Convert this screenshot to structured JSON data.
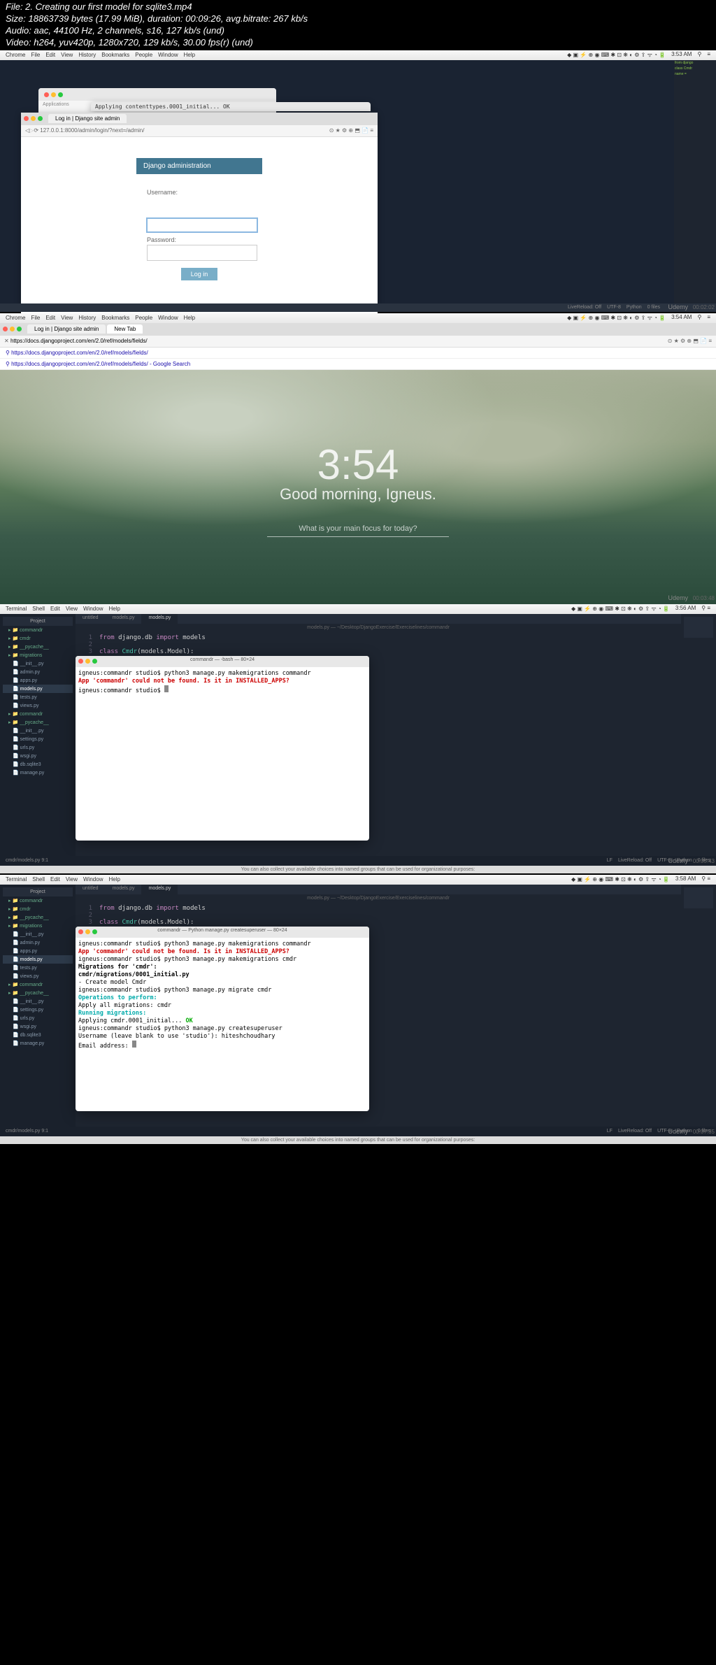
{
  "meta": {
    "l1": "File: 2. Creating our first model for sqlite3.mp4",
    "l2": "Size: 18863739 bytes (17.99 MiB), duration: 00:09:26, avg.bitrate: 267 kb/s",
    "l3": "Audio: aac, 44100 Hz, 2 channels, s16, 127 kb/s (und)",
    "l4": "Video: h264, yuv420p, 1280x720, 129 kb/s, 30.00 fps(r) (und)"
  },
  "menubar": {
    "chrome": [
      "Chrome",
      "File",
      "Edit",
      "View",
      "History",
      "Bookmarks",
      "People",
      "Window",
      "Help"
    ],
    "terminal": [
      "Terminal",
      "Shell",
      "Edit",
      "View",
      "Window",
      "Help"
    ],
    "time1": "3:53 AM",
    "time2": "3:54 AM",
    "time3": "3:56 AM",
    "time4": "3:58 AM"
  },
  "s1": {
    "finder_title": "Applications",
    "term_line": "Applying contenttypes.0001_initial... OK",
    "tab": "Log in | Django site admin",
    "url": "127.0.0.1:8000/admin/login/?next=/admin/",
    "django_hdr": "Django administration",
    "lbl_user": "Username:",
    "lbl_pass": "Password:",
    "btn": "Log in",
    "status": [
      "LiveReload: Off",
      "UTF-8",
      "Python",
      "0 files"
    ],
    "brand": "Udemy",
    "ts": "00:02:02"
  },
  "s2": {
    "tab1": "Log in | Django site admin",
    "tab2": "New Tab",
    "url": "https://docs.djangoproject.com/en/2.0/ref/models/fields/",
    "sugg1": "https://docs.djangoproject.com/en/2.0/ref/models/fields/",
    "sugg2": "https://docs.djangoproject.com/en/2.0/ref/models/fields/ - Google Search",
    "clock": "3:54",
    "greet": "Good morning, Igneus.",
    "focus": "What is your main focus for today?",
    "brand": "Udemy",
    "ts": "00:03:48"
  },
  "ide": {
    "path": "models.py — ~/Desktop/DjangoExercise/Exerciselines/commandr",
    "hdr": "Project",
    "tree": [
      "commandr",
      "cmdr",
      "__pycache__",
      "migrations",
      "__init__.py",
      "admin.py",
      "apps.py",
      "models.py",
      "tests.py",
      "views.py",
      "commandr",
      "__pycache__",
      "__init__.py",
      "settings.py",
      "urls.py",
      "wsgi.py",
      "db.sqlite3",
      "manage.py"
    ],
    "tabs": [
      "untitled",
      "models.py",
      "models.py"
    ],
    "code_l1": "from django.db import models",
    "code_l2": "class Cmdr(models.Model):",
    "bottom_left": "cmdr/models.py    9:1",
    "bottom_right": [
      "LF",
      "LiveReload: Off",
      "UTF-8",
      "Python",
      "0 files"
    ],
    "hint": "You can also collect your available choices into named groups that can be used for organizational purposes:"
  },
  "s3": {
    "term_title": "commandr — -bash — 80×24",
    "t1": "igneus:commandr studio$ python3 manage.py makemigrations commandr",
    "t2": "App 'commandr' could not be found. Is it in INSTALLED_APPS?",
    "t3": "igneus:commandr studio$ ",
    "brand": "Udemy",
    "ts": "00:05:43"
  },
  "s4": {
    "term_title": "commandr — Python manage.py createsuperuser — 80×24",
    "lines": [
      {
        "t": "igneus:commandr studio$ python3 manage.py makemigrations commandr",
        "c": ""
      },
      {
        "t": "App 'commandr' could not be found. Is it in INSTALLED_APPS?",
        "c": "err"
      },
      {
        "t": "igneus:commandr studio$ python3 manage.py makemigrations cmdr",
        "c": ""
      },
      {
        "t": "Migrations for 'cmdr':",
        "c": "mig"
      },
      {
        "t": "  cmdr/migrations/0001_initial.py",
        "c": "mig"
      },
      {
        "t": "    - Create model Cmdr",
        "c": ""
      },
      {
        "t": "igneus:commandr studio$ python3 manage.py migrate cmdr",
        "c": ""
      },
      {
        "t": "Operations to perform:",
        "c": "op"
      },
      {
        "t": "  Apply all migrations: cmdr",
        "c": ""
      },
      {
        "t": "Running migrations:",
        "c": "op"
      },
      {
        "t": "  Applying cmdr.0001_initial... OK",
        "c": "ok-line"
      },
      {
        "t": "igneus:commandr studio$ python3 manage.py createsuperuser",
        "c": ""
      },
      {
        "t": "Username (leave blank to use 'studio'): hiteshchoudhary",
        "c": ""
      },
      {
        "t": "Email address: ",
        "c": ""
      }
    ],
    "brand": "Udemy",
    "ts": "00:07:35"
  }
}
